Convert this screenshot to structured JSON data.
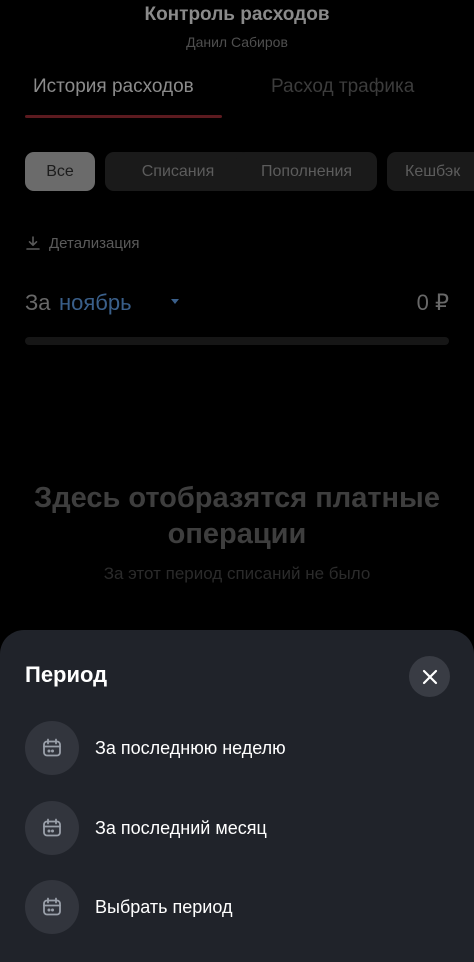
{
  "header": {
    "title": "Контроль расходов",
    "subtitle": "Данил Сабиров"
  },
  "tabs": [
    {
      "label": "История расходов",
      "active": true
    },
    {
      "label": "Расход трафика",
      "active": false
    }
  ],
  "filters": [
    {
      "label": "Все",
      "active": true
    },
    {
      "label": "Списания",
      "active": false
    },
    {
      "label": "Пополнения",
      "active": false
    },
    {
      "label": "Кешбэк",
      "active": false
    }
  ],
  "detail_link": "Детализация",
  "period": {
    "prefix": "За",
    "month": "ноябрь",
    "amount": "0 ₽",
    "progress": 0
  },
  "empty_state": {
    "title": "Здесь отобразятся платные операции",
    "subtitle": "За этот период списаний не было"
  },
  "sheet": {
    "title": "Период",
    "options": [
      {
        "label": "За последнюю неделю",
        "icon": "calendar-icon"
      },
      {
        "label": "За последний месяц",
        "icon": "calendar-icon"
      },
      {
        "label": "Выбрать период",
        "icon": "calendar-icon"
      }
    ]
  },
  "colors": {
    "background": "#000000",
    "sheet": "#20232a",
    "accent_underline": "#5c1a1f",
    "month_link": "#3a5f8a"
  }
}
